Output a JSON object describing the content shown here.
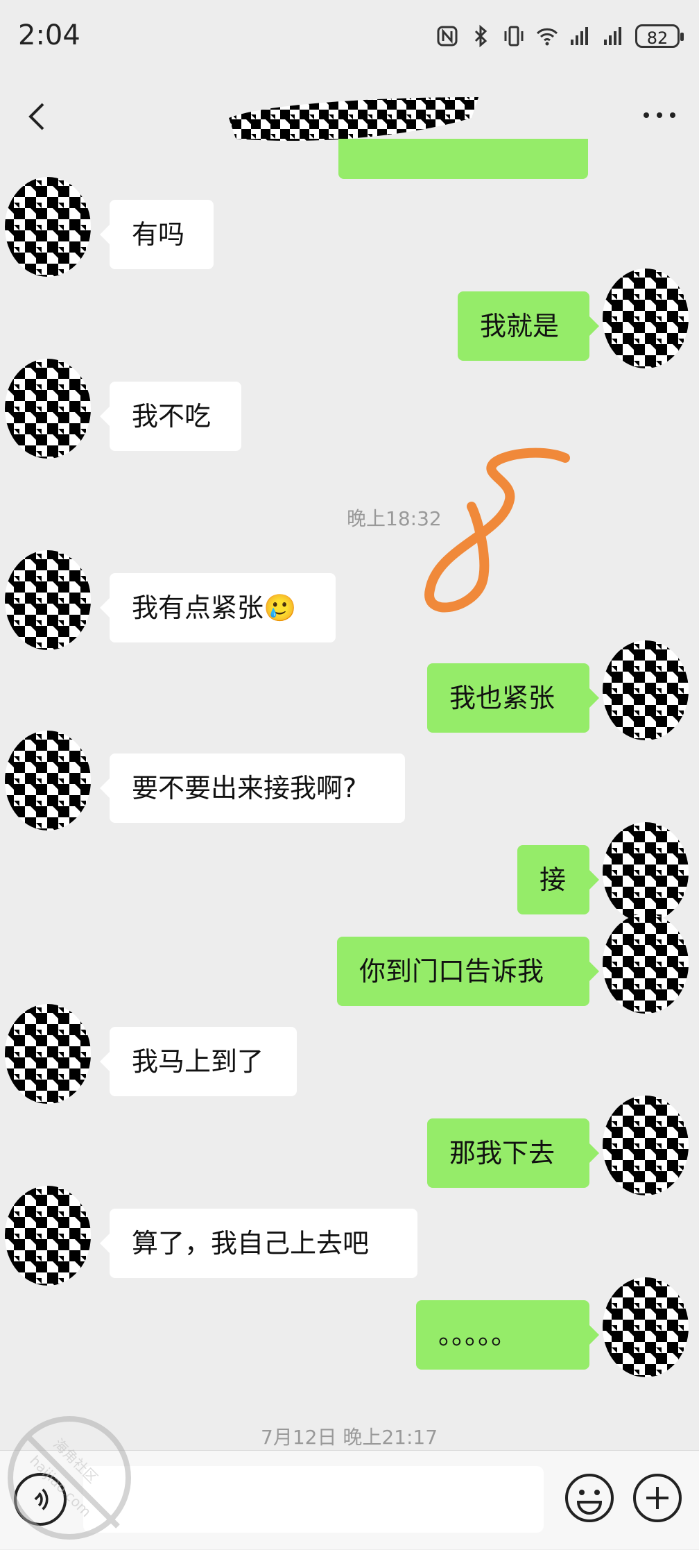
{
  "status_bar": {
    "time": "2:04",
    "battery": "82"
  },
  "nav": {
    "title": ""
  },
  "messages": [
    {
      "side": "left",
      "text": "有吗"
    },
    {
      "side": "right",
      "text": "我就是"
    },
    {
      "side": "left",
      "text": "我不吃"
    },
    {
      "side": "left",
      "text": "我有点紧张🥲"
    },
    {
      "side": "right",
      "text": "我也紧张"
    },
    {
      "side": "left",
      "text": "要不要出来接我啊?"
    },
    {
      "side": "right",
      "text": "接"
    },
    {
      "side": "right",
      "text": "你到门口告诉我"
    },
    {
      "side": "left",
      "text": "我马上到了"
    },
    {
      "side": "right",
      "text": "那我下去"
    },
    {
      "side": "left",
      "text": "算了，我自己上去吧"
    },
    {
      "side": "right",
      "text": "。。。。。"
    }
  ],
  "timestamps": [
    "晚上18:32",
    "7月12日 晚上21:17"
  ],
  "watermark": {
    "line1": "海角社区",
    "line2": "haijiao.com"
  },
  "colors": {
    "background": "#ededed",
    "bubble_right": "#95ec69",
    "bubble_left": "#ffffff",
    "scribble": "#f0893a"
  },
  "icons": [
    "back-icon",
    "more-icon",
    "voice-icon",
    "emoji-icon",
    "plus-icon",
    "nfc-icon",
    "bluetooth-icon",
    "vibrate-icon",
    "wifi-icon",
    "signal-icon"
  ]
}
